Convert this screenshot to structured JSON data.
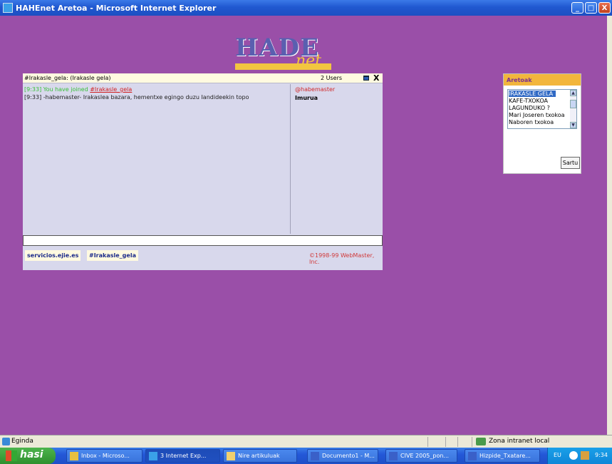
{
  "window": {
    "title": "HAHEnet Aretoa - Microsoft Internet Explorer",
    "minimize": "_",
    "maximize": "□",
    "close": "X"
  },
  "logo": {
    "text": "HADE",
    "script": "net"
  },
  "chat": {
    "header_title": "#Irakasle_gela: (Irakasle gela)",
    "users_count": "2 Users",
    "close_label": "X",
    "messages": [
      {
        "prefix": "[9:33] You have joined ",
        "channel": "#Irakasle_gela"
      },
      {
        "text": "[9:33] -habemaster- Irakaslea bazara, hementxe egingo duzu Iandideekin topo"
      }
    ],
    "users": [
      "@habemaster",
      "Imurua"
    ],
    "input_value": "",
    "tabs": [
      "servicios.ejie.es",
      "#Irakasle_gela"
    ],
    "copyright": "©1998-99 WebMaster, Inc."
  },
  "rooms": {
    "title": "Aretoak",
    "items": [
      "IRAKASLE GELA",
      "KAFE-TXOKOA",
      "LAGUNDUKO ?",
      "Mari Joseren txokoa",
      "Naboren txokoa"
    ],
    "selected_index": 0,
    "join_label": "Sartu"
  },
  "statusbar": {
    "text": "Eginda",
    "zone": "Zona intranet local"
  },
  "taskbar": {
    "start_label": "hasi",
    "tasks": [
      "Inbox - Microso...",
      "3 Internet Exp...",
      "Nire artikuluak",
      "Documento1 - M...",
      "CIVE 2005_pon...",
      "Hizpide_Txatare..."
    ],
    "active_task_index": 1,
    "tray_lang": "EU",
    "clock": "9:34"
  }
}
